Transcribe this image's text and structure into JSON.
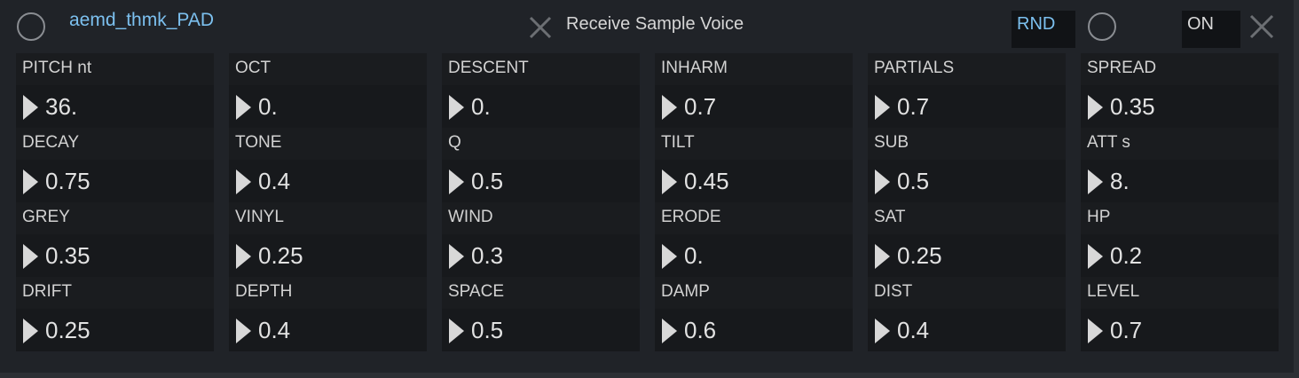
{
  "header": {
    "title": "aemd_thmk_PAD",
    "status_text": "Receive Sample Voice",
    "rnd_label": "RND",
    "on_label": "ON"
  },
  "params": [
    {
      "label": "PITCH nt",
      "value": "36."
    },
    {
      "label": "OCT",
      "value": "0."
    },
    {
      "label": "DESCENT",
      "value": "0."
    },
    {
      "label": "INHARM",
      "value": "0.7"
    },
    {
      "label": "PARTIALS",
      "value": "0.7"
    },
    {
      "label": "SPREAD",
      "value": "0.35"
    },
    {
      "label": "DECAY",
      "value": "0.75"
    },
    {
      "label": "TONE",
      "value": "0.4"
    },
    {
      "label": "Q",
      "value": "0.5"
    },
    {
      "label": "TILT",
      "value": "0.45"
    },
    {
      "label": "SUB",
      "value": "0.5"
    },
    {
      "label": "ATT s",
      "value": "8."
    },
    {
      "label": "GREY",
      "value": "0.35"
    },
    {
      "label": "VINYL",
      "value": "0.25"
    },
    {
      "label": "WIND",
      "value": "0.3"
    },
    {
      "label": "ERODE",
      "value": "0."
    },
    {
      "label": "SAT",
      "value": "0.25"
    },
    {
      "label": "HP",
      "value": "0.2"
    },
    {
      "label": "DRIFT",
      "value": "0.25"
    },
    {
      "label": "DEPTH",
      "value": "0.4"
    },
    {
      "label": "SPACE",
      "value": "0.5"
    },
    {
      "label": "DAMP",
      "value": "0.6"
    },
    {
      "label": "DIST",
      "value": "0.4"
    },
    {
      "label": "LEVEL",
      "value": "0.7"
    }
  ],
  "colors": {
    "accent": "#7cc0ef",
    "background": "#202328",
    "label_bg": "#1a1c1f",
    "number_bg": "#17191c"
  },
  "icons": {
    "left_circle": "circle-toggle-icon",
    "status_x": "close-x-icon",
    "right_circle": "circle-toggle-icon",
    "right_x": "close-x-icon",
    "number_arrow": "triangle-right-icon"
  }
}
